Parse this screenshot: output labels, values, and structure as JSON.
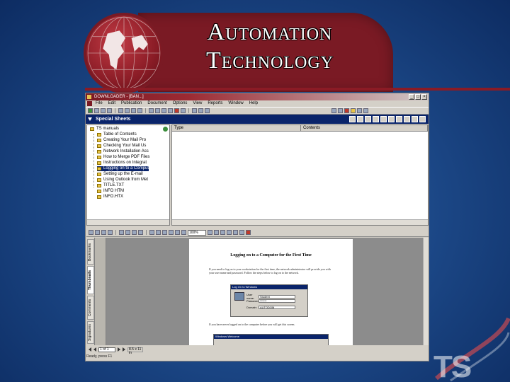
{
  "slide": {
    "title_line1": "Automation",
    "title_line2": "Technology",
    "logo_text": "TS"
  },
  "window": {
    "title": "DOWNLOADER - [BAN...]",
    "menu": [
      "File",
      "Edit",
      "Publication",
      "Document",
      "Options",
      "View",
      "Reports",
      "Window",
      "Help"
    ]
  },
  "special_sheets": {
    "label": "Special Sheets"
  },
  "tree": {
    "root": "TS manuals",
    "items": [
      "Table of Contents",
      "Creating Your Mail Pro",
      "Checking Your Mail Us",
      "Network Installation Ass",
      "How to Merge PDF Files",
      "Instructions on Integrat",
      "Logging on to a Comput",
      "Setting up the E-mail",
      "Using Outlook from Met",
      "TITLE.TXT",
      "INFO HTM",
      "INFO.HTX"
    ],
    "selected_index": 6
  },
  "list": {
    "columns": [
      "Type",
      "Contents"
    ]
  },
  "viewer": {
    "zoom": "100%",
    "side_tabs": [
      "Bookmarks",
      "Thumbnails",
      "Comments",
      "Signatures"
    ],
    "active_tab": "Thumbnails",
    "page_indicator": "1 of 1",
    "page_size": "8.5 x 11 in",
    "status_text": "Ready, press F1"
  },
  "document": {
    "heading": "Logging on to a Computer for the First Time",
    "para1": "If you need to log on to your workstation for the first time, the network administrator will provide you with your user name and password. Follow the steps below to log on to the network.",
    "dialog_title": "Log On to Windows",
    "dialog_fields": [
      {
        "label": "User name:",
        "value": "Student"
      },
      {
        "label": "Password:",
        "value": "******"
      },
      {
        "label": "Domain:",
        "value": "AUTODOM"
      }
    ],
    "para2": "If you have never logged on to the computer before you will get this screen.",
    "dialog2_title": "Windows Welcome"
  },
  "colors": {
    "banner": "#7a1a24",
    "selection": "#0a246a",
    "background": "#1d4a8a"
  }
}
